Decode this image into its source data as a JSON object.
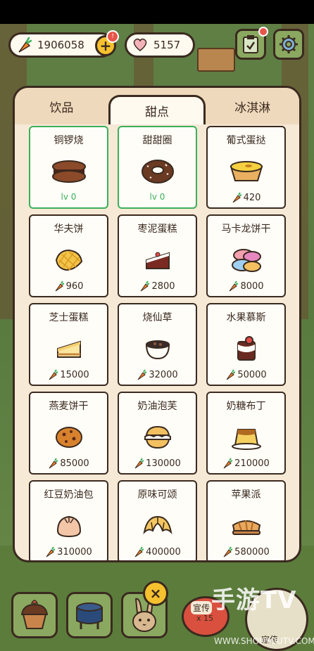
{
  "header": {
    "carrots": "1906058",
    "hearts": "5157",
    "notice_badge": "!"
  },
  "tabs": [
    {
      "label": "饮品",
      "active": false
    },
    {
      "label": "甜点",
      "active": true
    },
    {
      "label": "冰淇淋",
      "active": false
    }
  ],
  "items": [
    {
      "name": "铜锣烧",
      "level": "lv 0",
      "icon": "dorayaki-icon"
    },
    {
      "name": "甜甜圈",
      "level": "lv 0",
      "icon": "donut-icon"
    },
    {
      "name": "葡式蛋挞",
      "price": "420",
      "icon": "egg-tart-icon"
    },
    {
      "name": "华夫饼",
      "price": "960",
      "icon": "waffle-icon"
    },
    {
      "name": "枣泥蛋糕",
      "price": "2800",
      "icon": "date-cake-icon"
    },
    {
      "name": "马卡龙饼干",
      "price": "8000",
      "icon": "macaron-icon"
    },
    {
      "name": "芝士蛋糕",
      "price": "15000",
      "icon": "cheesecake-icon"
    },
    {
      "name": "烧仙草",
      "price": "32000",
      "icon": "grass-jelly-icon"
    },
    {
      "name": "水果慕斯",
      "price": "50000",
      "icon": "fruit-mousse-icon"
    },
    {
      "name": "燕麦饼干",
      "price": "85000",
      "icon": "oat-cookie-icon"
    },
    {
      "name": "奶油泡芙",
      "price": "130000",
      "icon": "cream-puff-icon"
    },
    {
      "name": "奶糖布丁",
      "price": "210000",
      "icon": "pudding-icon"
    },
    {
      "name": "红豆奶油包",
      "price": "310000",
      "icon": "bun-icon"
    },
    {
      "name": "原味可颂",
      "price": "400000",
      "icon": "croissant-icon"
    },
    {
      "name": "苹果派",
      "price": "580000",
      "icon": "apple-pie-icon"
    }
  ],
  "bottom": {
    "close_label": "×",
    "promo_label": "宣传",
    "promo_count": "x 15",
    "round_label": "宣传"
  },
  "watermark": {
    "main": "手游TV",
    "url": "WWW.SHOUYOUTV.COM"
  },
  "colors": {
    "owned_border": "#3bb05a",
    "accent_yellow": "#f5c12e",
    "panel_bg": "#f6e9d6"
  }
}
